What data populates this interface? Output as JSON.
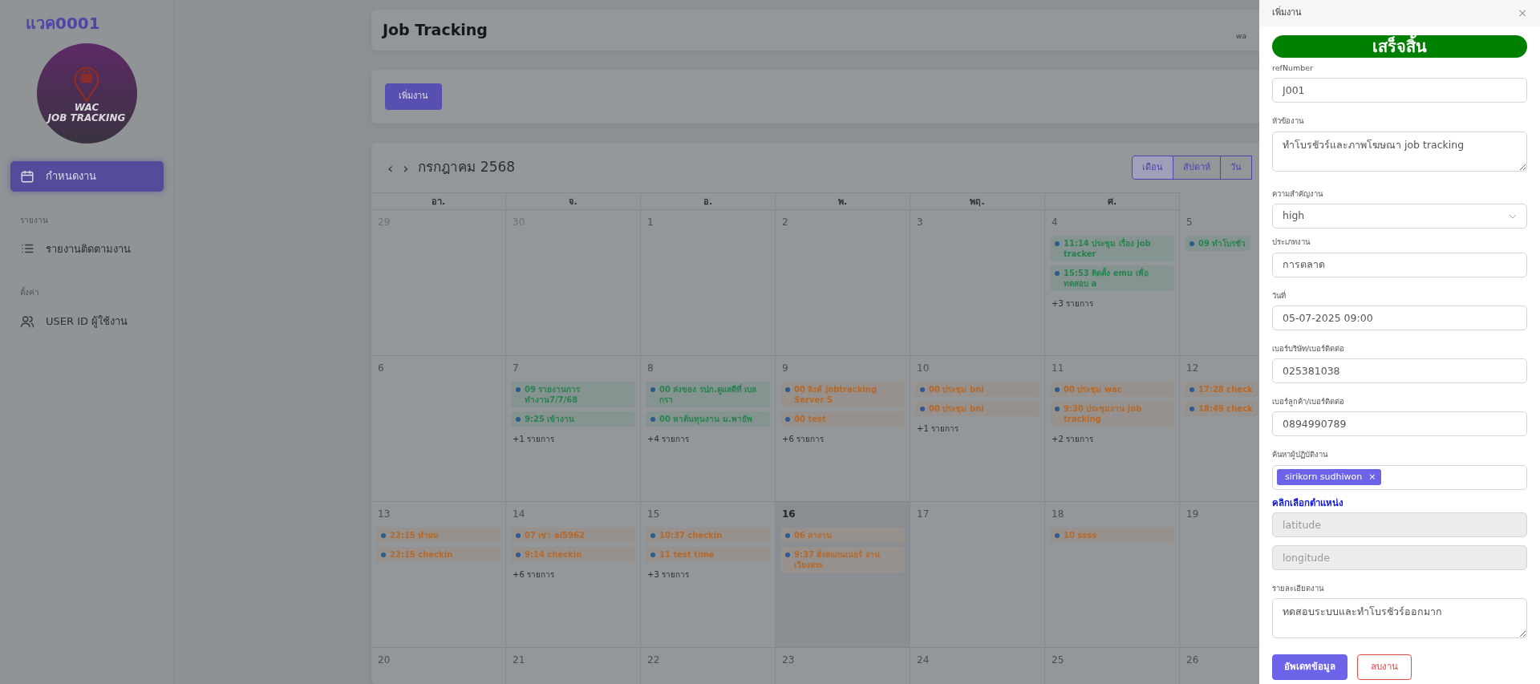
{
  "sidebar": {
    "title": "แวค0001",
    "logo_lines": [
      "WAC",
      "JOB TRACKING"
    ],
    "sections": [
      {
        "items": [
          {
            "label": "กำหนดงาน",
            "selected": true
          }
        ]
      },
      {
        "heading": "รายงาน",
        "items": [
          {
            "label": "รายงานติดตามงาน",
            "selected": false
          }
        ]
      },
      {
        "heading": "ตั้งค่า",
        "items": [
          {
            "label": "USER ID ผู้ใช้งาน",
            "selected": false
          }
        ]
      }
    ]
  },
  "header": {
    "title": "Job Tracking",
    "user_fragment": "wa"
  },
  "toolbar": {
    "add_button": "เพิ่มงาน"
  },
  "calendar": {
    "prev": "‹",
    "next": "›",
    "month": "กรกฎาคม 2568",
    "views": [
      {
        "label": "เดือน",
        "selected": true
      },
      {
        "label": "สัปดาห์",
        "selected": false
      },
      {
        "label": "วัน",
        "selected": false
      }
    ],
    "weekdays": [
      "อา.",
      "จ.",
      "อ.",
      "พ.",
      "พฤ.",
      "ศ."
    ],
    "weeks": [
      [
        {
          "day": "29",
          "muted": true,
          "today": false
        },
        {
          "day": "30",
          "muted": true,
          "today": false
        },
        {
          "day": "1",
          "muted": false,
          "today": false
        },
        {
          "day": "2",
          "muted": false,
          "today": false
        },
        {
          "day": "3",
          "muted": false,
          "today": false
        },
        {
          "day": "4",
          "muted": false,
          "today": false,
          "events": [
            {
              "text": "11:14 ประชุม เรื่อง job tracker",
              "color": "#2a8250"
            },
            {
              "text": "15:53 ติดตั้ง emu เพื่อทดสอบ a",
              "color": "#2a8250"
            }
          ],
          "more": "+3 รายการ"
        },
        {
          "day": "5",
          "muted": false,
          "today": false,
          "events": [
            {
              "text": "09 ทำโบรชัว",
              "color": "#2a8250"
            }
          ]
        }
      ],
      [
        {
          "day": "6",
          "muted": false,
          "today": false
        },
        {
          "day": "7",
          "muted": false,
          "today": false,
          "events": [
            {
              "text": "09 รายงานการทำงาน7/7/68",
              "color": "#2a8250"
            },
            {
              "text": "9:25 เข้างาน",
              "color": "#2a8250"
            }
          ],
          "more": "+1 รายการ"
        },
        {
          "day": "8",
          "muted": false,
          "today": false,
          "events": [
            {
              "text": "00 ส่งของ รปภ.ดูแลดีที่ เบลกรา",
              "color": "#2a8250"
            },
            {
              "text": "00 หาต้นทุนงาน ม.พายัพ",
              "color": "#2a8250"
            }
          ],
          "more": "+4 รายการ"
        },
        {
          "day": "9",
          "muted": false,
          "today": false,
          "events": [
            {
              "text": "00 ลิงค์ jobtracking Server S",
              "color": "#b5692a"
            },
            {
              "text": "00 test",
              "color": "#b5692a"
            }
          ],
          "more": "+6 รายการ"
        },
        {
          "day": "10",
          "muted": false,
          "today": false,
          "events": [
            {
              "text": "00 ประชุม bni",
              "color": "#b5692a"
            },
            {
              "text": "00 ประชุม bni",
              "color": "#b5692a"
            }
          ],
          "more": "+1 รายการ"
        },
        {
          "day": "11",
          "muted": false,
          "today": false,
          "events": [
            {
              "text": "00 ประชุม wac",
              "color": "#b5692a"
            },
            {
              "text": "9:30 ประชุมงาน job tracking",
              "color": "#b5692a"
            }
          ],
          "more": "+2 รายการ"
        },
        {
          "day": "12",
          "muted": false,
          "today": false,
          "events": [
            {
              "text": "17:28 check",
              "color": "#b5692a"
            },
            {
              "text": "18:49 check",
              "color": "#b5692a"
            }
          ]
        }
      ],
      [
        {
          "day": "13",
          "muted": false,
          "today": false,
          "events": [
            {
              "text": "22:15 ทำผม",
              "color": "#b5692a"
            },
            {
              "text": "22:15 checkin",
              "color": "#b5692a"
            }
          ]
        },
        {
          "day": "14",
          "muted": false,
          "today": false,
          "events": [
            {
              "text": "07 เช่า ai5962",
              "color": "#b5692a"
            },
            {
              "text": "9:14 checkin",
              "color": "#b5692a"
            }
          ],
          "more": "+6 รายการ"
        },
        {
          "day": "15",
          "muted": false,
          "today": false,
          "events": [
            {
              "text": "10:37 checkin",
              "color": "#b5692a"
            },
            {
              "text": "11 test time",
              "color": "#b5692a"
            }
          ],
          "more": "+3 รายการ"
        },
        {
          "day": "16",
          "muted": false,
          "today": true,
          "events": [
            {
              "text": "06 ลางาน",
              "color": "#b5692a"
            },
            {
              "text": "9:37 สั่งสแกนเนอร์ งานเวียงสระ",
              "color": "#b5692a"
            }
          ]
        },
        {
          "day": "17",
          "muted": false,
          "today": false
        },
        {
          "day": "18",
          "muted": false,
          "today": false,
          "events": [
            {
              "text": "10 ssss",
              "color": "#b5692a"
            }
          ]
        },
        {
          "day": "19",
          "muted": false,
          "today": false
        }
      ],
      [
        {
          "day": "20",
          "muted": false,
          "today": false
        },
        {
          "day": "21",
          "muted": false,
          "today": false
        },
        {
          "day": "22",
          "muted": false,
          "today": false
        },
        {
          "day": "23",
          "muted": false,
          "today": false
        },
        {
          "day": "24",
          "muted": false,
          "today": false
        },
        {
          "day": "25",
          "muted": false,
          "today": false
        },
        {
          "day": "26",
          "muted": false,
          "today": false
        }
      ]
    ]
  },
  "panel": {
    "title": "เพิ่มงาน",
    "close": "×",
    "status": "เสร็จสิ้น",
    "fields": [
      {
        "kind": "input",
        "label": "refNumber",
        "value": "J001",
        "disabled": false
      },
      {
        "kind": "textarea",
        "label": "หัวข้องาน",
        "value": "ทำโบรชัวร์และภาพโฆษณา job tracking",
        "disabled": false
      },
      {
        "kind": "select",
        "label": "ความสำคัญงาน",
        "value": "high",
        "disabled": false
      },
      {
        "kind": "input",
        "label": "ประเภทงาน",
        "value": "การตลาด",
        "disabled": false
      },
      {
        "kind": "input",
        "label": "วันที่",
        "value": "05-07-2025 09:00",
        "disabled": false
      },
      {
        "kind": "input",
        "label": "เบอร์บริษัท/เบอร์ติดต่อ",
        "value": "025381038",
        "disabled": false
      },
      {
        "kind": "input",
        "label": "เบอร์ลูกค้า/เบอร์ติดต่อ",
        "value": "0894990789",
        "disabled": false
      },
      {
        "kind": "tags",
        "label": "ค้นหาผู้ปฏิบัติงาน",
        "tags": [
          {
            "text": "sirikorn sudhiwon",
            "remove": "×"
          }
        ],
        "disabled": false
      },
      {
        "kind": "link",
        "text": "คลิกเลือกตำแหน่ง"
      },
      {
        "kind": "input",
        "placeholder": "latitude",
        "disabled": true
      },
      {
        "kind": "input",
        "placeholder": "longitude",
        "disabled": true
      },
      {
        "kind": "textarea",
        "label": "รายละเอียดงาน",
        "value": "ทดสอบระบบและทำโบรชัวร์ออกมาก",
        "disabled": false
      }
    ],
    "buttons": [
      {
        "label": "อัพเดทข้อมูล",
        "kind": "primary"
      },
      {
        "label": "ลบงาน",
        "kind": "danger"
      }
    ]
  }
}
